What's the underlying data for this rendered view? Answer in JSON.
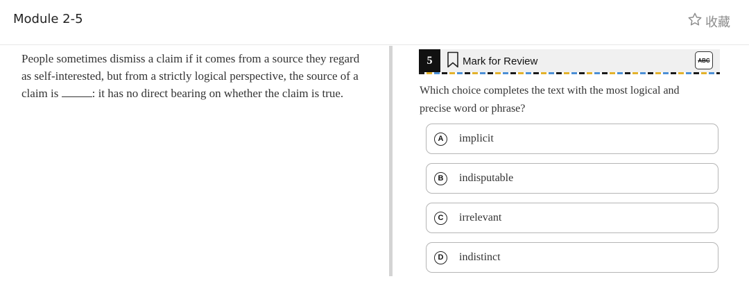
{
  "header": {
    "module_title": "Module 2-5",
    "favorite_label": "收藏"
  },
  "passage": {
    "before_blank": "People sometimes dismiss a claim if it comes from a source they regard as self-interested, but from a strictly logical perspective, the source of a claim is ",
    "after_blank": ": it has no direct bearing on whether the claim is true."
  },
  "question": {
    "number": "5",
    "mark_for_review_label": "Mark for Review",
    "abc_label": "ABC",
    "prompt": "Which choice completes the text with the most logical and precise word or phrase?",
    "choices": [
      {
        "letter": "A",
        "text": "implicit"
      },
      {
        "letter": "B",
        "text": "indisputable"
      },
      {
        "letter": "C",
        "text": "irrelevant"
      },
      {
        "letter": "D",
        "text": "indistinct"
      }
    ]
  },
  "icons": {
    "favorite": "star-outline-icon",
    "bookmark": "bookmark-outline-icon"
  }
}
